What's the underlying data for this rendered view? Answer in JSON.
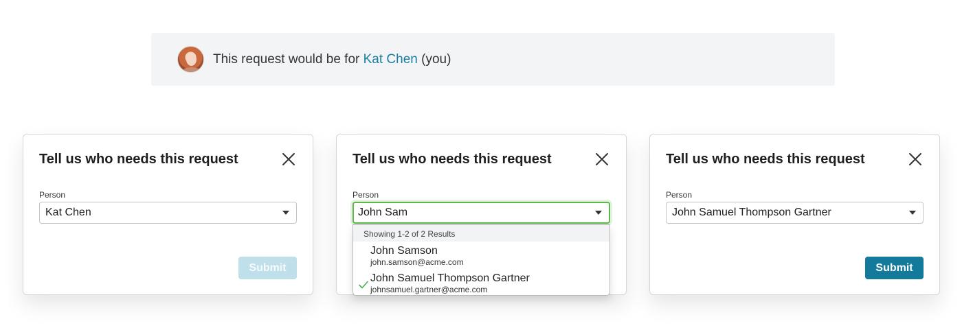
{
  "banner": {
    "prefix": "This request would be for ",
    "name": "Kat Chen",
    "suffix": " (you)"
  },
  "dialogs": [
    {
      "title": "Tell us who needs this request",
      "field_label": "Person",
      "value": "Kat Chen",
      "submit_label": "Submit",
      "submit_state": "disabled"
    },
    {
      "title": "Tell us who needs this request",
      "field_label": "Person",
      "value": "John Sam",
      "dropdown": {
        "header": "Showing 1-2 of 2 Results",
        "options": [
          {
            "name": "John Samson",
            "email": "john.samson@acme.com",
            "selected": false
          },
          {
            "name": "John Samuel Thompson Gartner",
            "email": "johnsamuel.gartner@acme.com",
            "selected": true
          }
        ]
      }
    },
    {
      "title": "Tell us who needs this request",
      "field_label": "Person",
      "value": "John Samuel Thompson Gartner",
      "submit_label": "Submit",
      "submit_state": "enabled"
    }
  ],
  "colors": {
    "accent": "#137a9c",
    "accent_disabled": "#bfe0ea",
    "link": "#1a7fa0",
    "focus": "#5fb54a",
    "banner_bg": "#f3f4f6"
  },
  "icons": {
    "close": "close-icon",
    "caret": "chevron-down-icon",
    "check": "check-icon",
    "avatar": "avatar"
  }
}
